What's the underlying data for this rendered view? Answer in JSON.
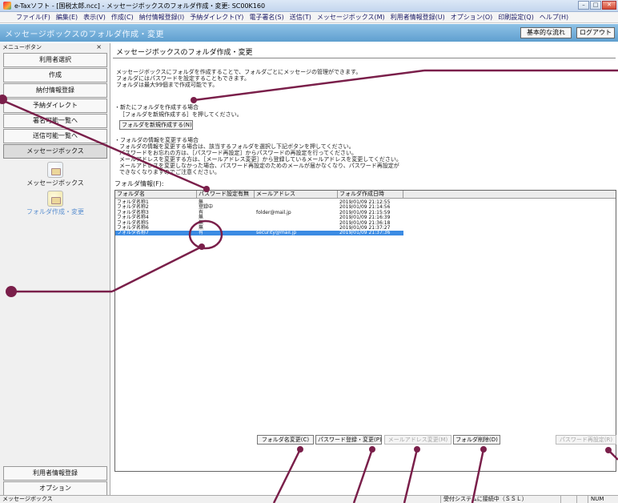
{
  "window": {
    "title": "e-Taxソフト - [国税太郎.ncc] - メッセージボックスのフォルダ作成・変更: SC00K160"
  },
  "menu": [
    "ファイル(F)",
    "編集(E)",
    "表示(V)",
    "作成(C)",
    "納付情報登録(I)",
    "予納ダイレクト(Y)",
    "電子署名(S)",
    "送信(T)",
    "メッセージボックス(M)",
    "利用者情報登録(U)",
    "オプション(O)",
    "印刷設定(Q)",
    "ヘルプ(H)"
  ],
  "header": {
    "title": "メッセージボックスのフォルダ作成・変更",
    "basic_flow": "基本的な流れ",
    "logout": "ログアウト"
  },
  "sidebar": {
    "head": "メニューボタン",
    "close": "×",
    "items": [
      "利用者選択",
      "作成",
      "納付情報登録",
      "予納ダイレクト",
      "署名可能一覧へ",
      "送信可能一覧へ",
      "メッセージボックス"
    ],
    "subitems": [
      "メッセージボックス",
      "フォルダ作成・変更"
    ],
    "bottom": [
      "利用者情報登録",
      "オプション"
    ]
  },
  "page": {
    "title": "メッセージボックスのフォルダ作成・変更",
    "intro": [
      "メッセージボックスにフォルダを作成することで、フォルダごとにメッセージの管理ができます。",
      "フォルダにはパスワードを設定することもできます。",
      "フォルダは最大99個まで作成可能です。"
    ],
    "new_head": "・新たにフォルダを作成する場合",
    "new_text": "［フォルダを新規作成する］を押してください。",
    "new_button": "フォルダを新規作成する(N)",
    "change_head": "・フォルダの情報を変更する場合",
    "change_text": [
      "フォルダの情報を変更する場合は、該当するフォルダを選択し下記ボタンを押してください。",
      "パスワードをお忘れの方は、［パスワード再設定］からパスワードの再設定を行ってください。",
      "メールアドレスを変更する方は、［メールアドレス変更］から登録しているメールアドレスを変更してください。",
      "メールアドレスを変更しなかった場合、パスワード再設定のためのメールが届かなくなり、パスワード再設定が",
      "できなくなりますのでご注意ください。"
    ],
    "table_label": "フォルダ情報(F):"
  },
  "table": {
    "headers": [
      "フォルダ名",
      "パスワード設定有無",
      "メールアドレス",
      "フォルダ作成日時"
    ],
    "rows": [
      [
        "フォルダ名称1",
        "無",
        "",
        "2019/01/09 21:12:55"
      ],
      [
        "フォルダ名称2",
        "登録中",
        "",
        "2019/01/09 21:14:56"
      ],
      [
        "フォルダ名称3",
        "有",
        "folder@mail.jp",
        "2019/01/09 21:15:59"
      ],
      [
        "フォルダ名称4",
        "無",
        "",
        "2019/01/09 21:16:39"
      ],
      [
        "フォルダ名称5",
        "無",
        "",
        "2019/01/09 21:36:18"
      ],
      [
        "フォルダ名称6",
        "無",
        "",
        "2019/01/09 21:37:27"
      ],
      [
        "フォルダ名称7",
        "有",
        "security@mail.jp",
        "2019/01/09 21:37:36"
      ]
    ],
    "selected_index": 6
  },
  "buttons": {
    "rename": "フォルダ名変更(C)",
    "password": "パスワード登録・変更(P)",
    "mail": "メールアドレス変更(M)",
    "delete": "フォルダ削除(D)",
    "reset": "パスワード再設定(R)"
  },
  "status": {
    "left": "メッセージボックス",
    "conn": "受付システムに接続中（ＳＳＬ）",
    "num": "NUM"
  },
  "colors": {
    "header": "#6fa8d6",
    "selection": "#3b8be3",
    "annotation": "#7a1f4a"
  }
}
